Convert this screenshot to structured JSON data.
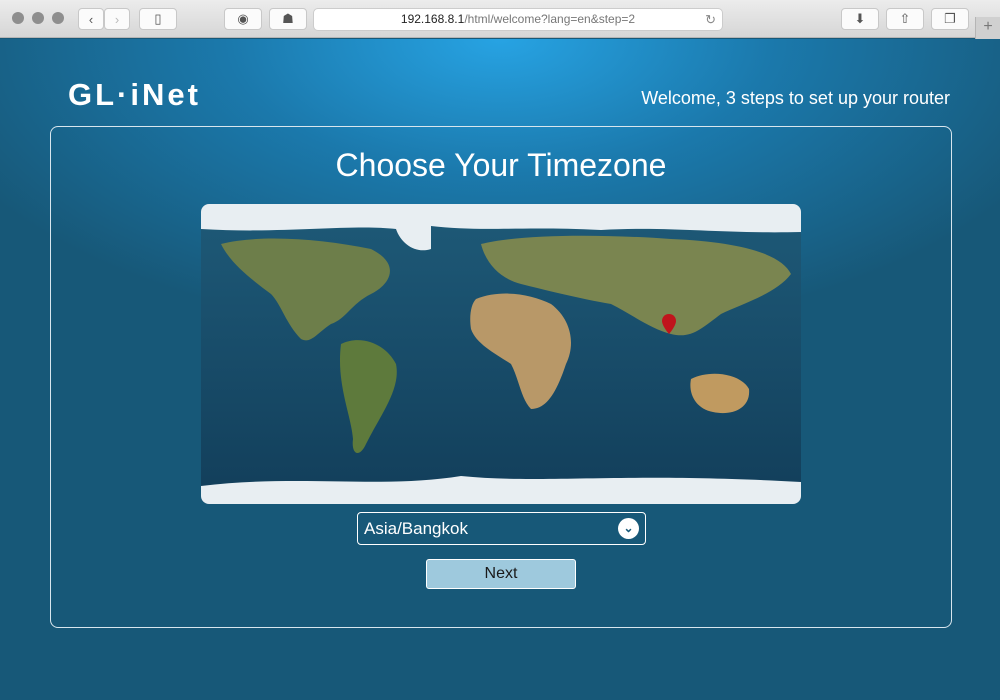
{
  "browser": {
    "url_host": "192.168.8.1",
    "url_path": "/html/welcome?lang=en&step=2",
    "new_tab": "+"
  },
  "header": {
    "logo": "GL·iNet",
    "welcome": "Welcome, 3 steps to set up your router"
  },
  "main": {
    "title": "Choose Your Timezone",
    "timezone": "Asia/Bangkok",
    "next_label": "Next"
  },
  "colors": {
    "background": "#175878",
    "accent": "#27a3e3",
    "button": "#9ec9dd",
    "marker": "#c0141c"
  }
}
